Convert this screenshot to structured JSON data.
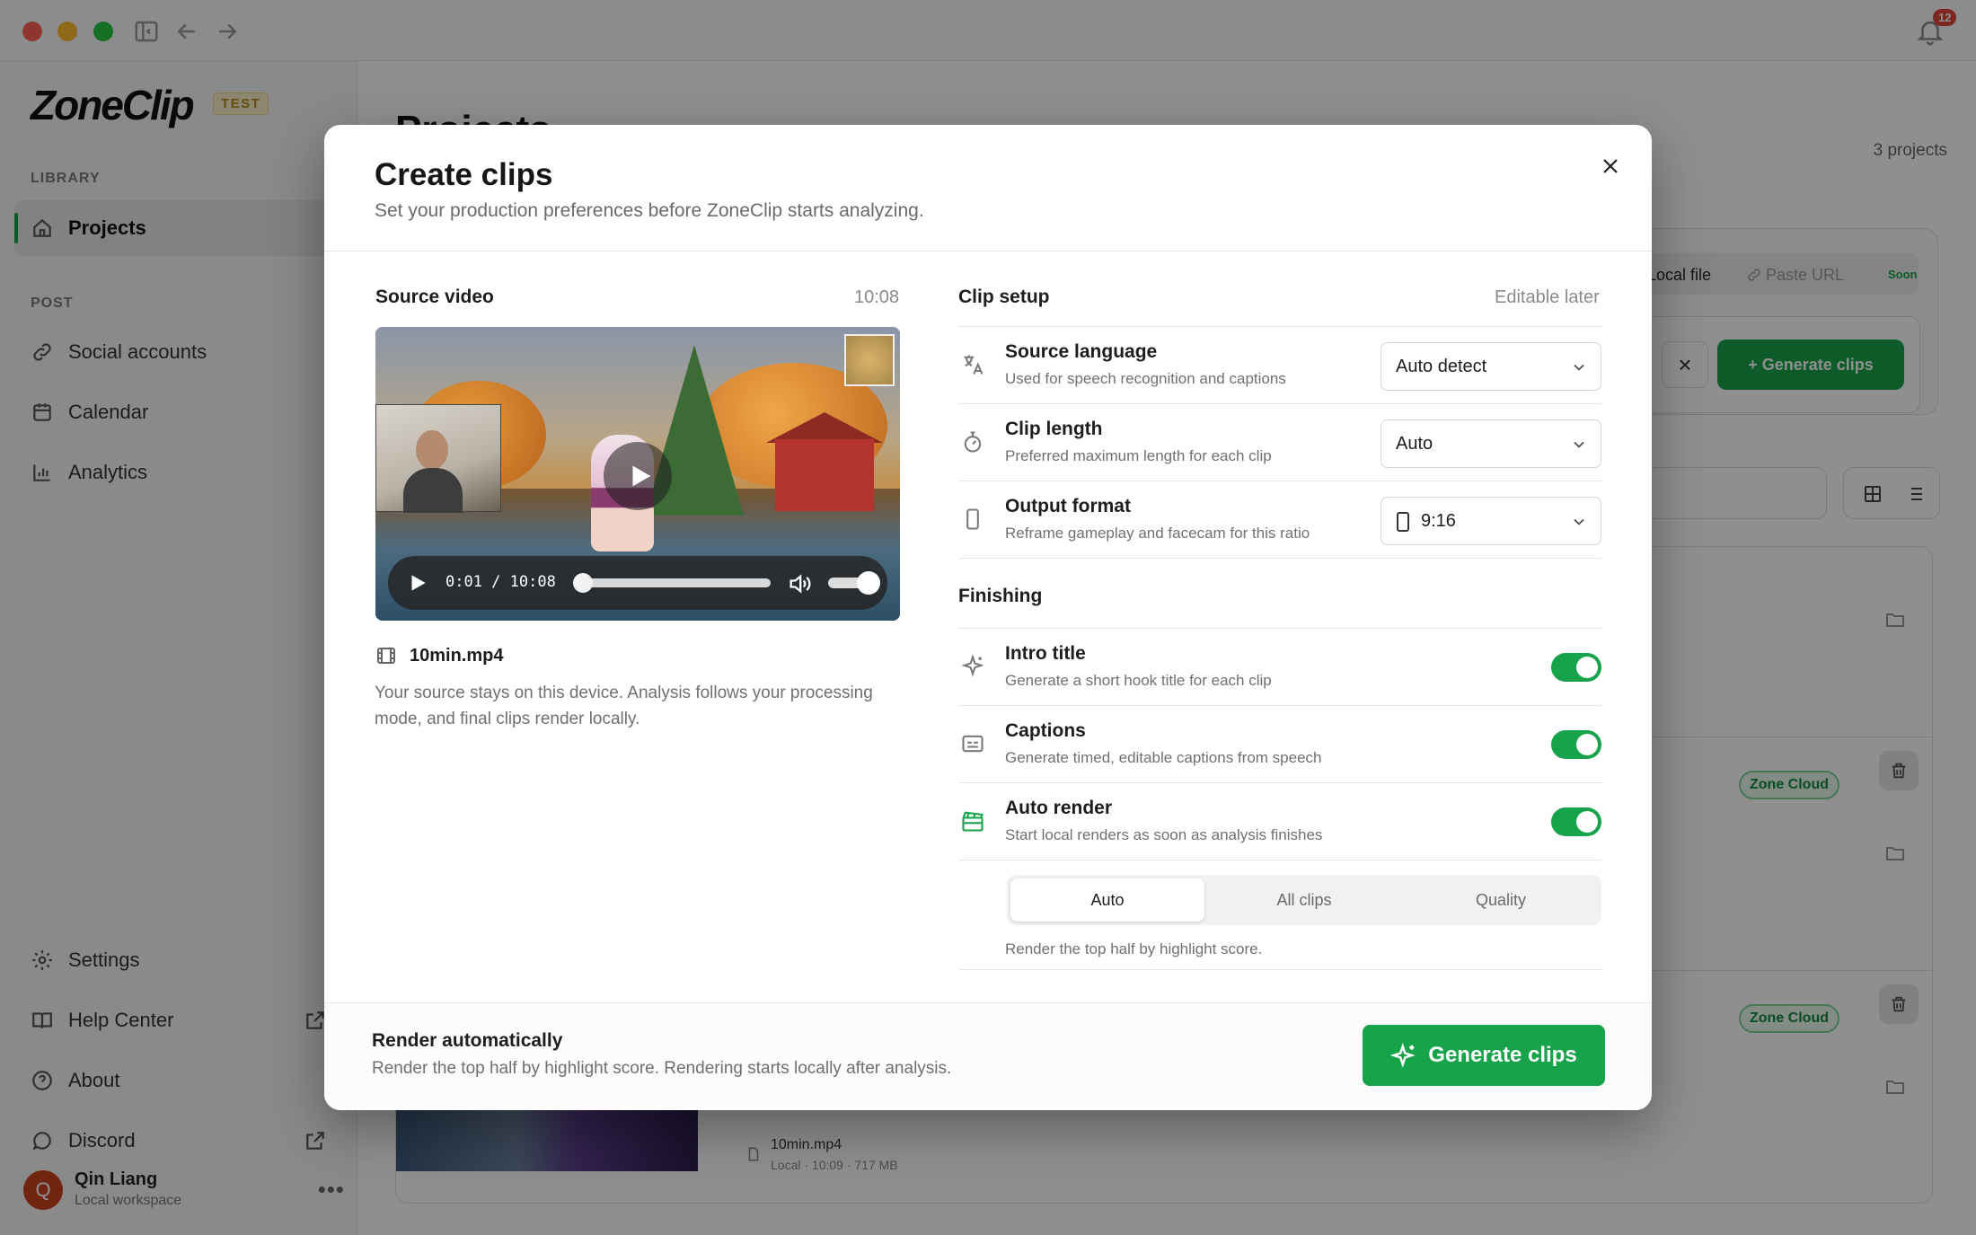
{
  "app": {
    "notification_count": "12",
    "logo": "ZoneClip",
    "logo_tag": "TEST",
    "sidebar": {
      "library_heading": "LIBRARY",
      "post_heading": "POST",
      "projects": "Projects",
      "social_accounts": "Social accounts",
      "calendar": "Calendar",
      "analytics": "Analytics",
      "settings": "Settings",
      "help_center": "Help Center",
      "about": "About",
      "discord": "Discord"
    },
    "user": {
      "initial": "Q",
      "name": "Qin Liang",
      "workspace": "Local workspace"
    },
    "main": {
      "title": "Projects",
      "count": "3 projects",
      "tab_local": "Local file",
      "tab_url": "Paste URL",
      "tab_url_badge": "Soon",
      "clear": "×",
      "generate": "+  Generate clips",
      "badge": "Zone Cloud",
      "file_name": "10min.mp4",
      "file_meta": "Local · 10:09 · 717 MB"
    }
  },
  "modal": {
    "title": "Create clips",
    "subtitle": "Set your production preferences before ZoneClip starts analyzing.",
    "source": {
      "label": "Source video",
      "duration": "10:08",
      "time_display": "0:01 / 10:08",
      "progress_fraction": 0.002,
      "file_name": "10min.mp4",
      "note": "Your source stays on this device. Analysis follows your processing mode, and final clips render locally."
    },
    "clip_setup": {
      "label": "Clip setup",
      "meta": "Editable later",
      "rows": [
        {
          "label": "Source language",
          "desc": "Used for speech recognition and captions",
          "value": "Auto detect",
          "icon": "translate-icon"
        },
        {
          "label": "Clip length",
          "desc": "Preferred maximum length for each clip",
          "value": "Auto",
          "icon": "stopwatch-icon"
        },
        {
          "label": "Output format",
          "desc": "Reframe gameplay and facecam for this ratio",
          "value": "9:16",
          "icon": "phone-icon"
        }
      ]
    },
    "finishing": {
      "label": "Finishing",
      "rows": [
        {
          "label": "Intro title",
          "desc": "Generate a short hook title for each clip",
          "on": true,
          "icon": "sparkle-icon"
        },
        {
          "label": "Captions",
          "desc": "Generate timed, editable captions from speech",
          "on": true,
          "icon": "captions-icon"
        },
        {
          "label": "Auto render",
          "desc": "Start local renders as soon as analysis finishes",
          "on": true,
          "icon": "clapperboard-icon"
        }
      ],
      "modes": [
        "Auto",
        "All clips",
        "Quality"
      ],
      "selected_mode": "Auto",
      "mode_note": "Render the top half by highlight score."
    },
    "footer": {
      "title": "Render automatically",
      "desc": "Render the top half by highlight score. Rendering starts locally after analysis.",
      "button": "Generate clips"
    }
  },
  "colors": {
    "accent": "#16a34a",
    "danger": "#e0453a"
  }
}
